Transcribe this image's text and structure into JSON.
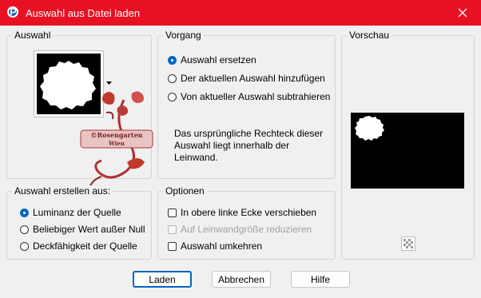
{
  "window": {
    "title": "Auswahl aus Datei laden",
    "accent": "#e81123"
  },
  "auswahl": {
    "legend": "Auswahl"
  },
  "vorgang": {
    "legend": "Vorgang",
    "options": [
      "Auswahl ersetzen",
      "Der aktuellen Auswahl hinzufügen",
      "Von aktueller Auswahl subtrahieren"
    ],
    "selected": 0,
    "description": [
      "Das ursprüngliche Rechteck dieser",
      "Auswahl liegt innerhalb der",
      "Leinwand."
    ]
  },
  "vorschau": {
    "legend": "Vorschau"
  },
  "erstellen": {
    "legend": "Auswahl erstellen aus:",
    "options": [
      "Luminanz der Quelle",
      "Beliebiger Wert außer Null",
      "Deckfähigkeit der Quelle"
    ],
    "selected": 0
  },
  "optionen": {
    "legend": "Optionen",
    "items": [
      {
        "label": "In obere linke Ecke verschieben",
        "checked": false,
        "enabled": true
      },
      {
        "label": "Auf Leinwandgröße reduzieren",
        "checked": false,
        "enabled": false
      },
      {
        "label": "Auswahl umkehren",
        "checked": false,
        "enabled": true
      }
    ]
  },
  "buttons": {
    "load": "Laden",
    "cancel": "Abbrechen",
    "help": "Hilfe"
  },
  "watermark": {
    "text_line1": "©Rosengarten",
    "text_line2": "Wien"
  },
  "icons": {
    "app": "paintshop-icon",
    "close": "close-icon",
    "dropdown": "dropdown-arrow-icon",
    "transparency": "checkerboard-icon"
  }
}
